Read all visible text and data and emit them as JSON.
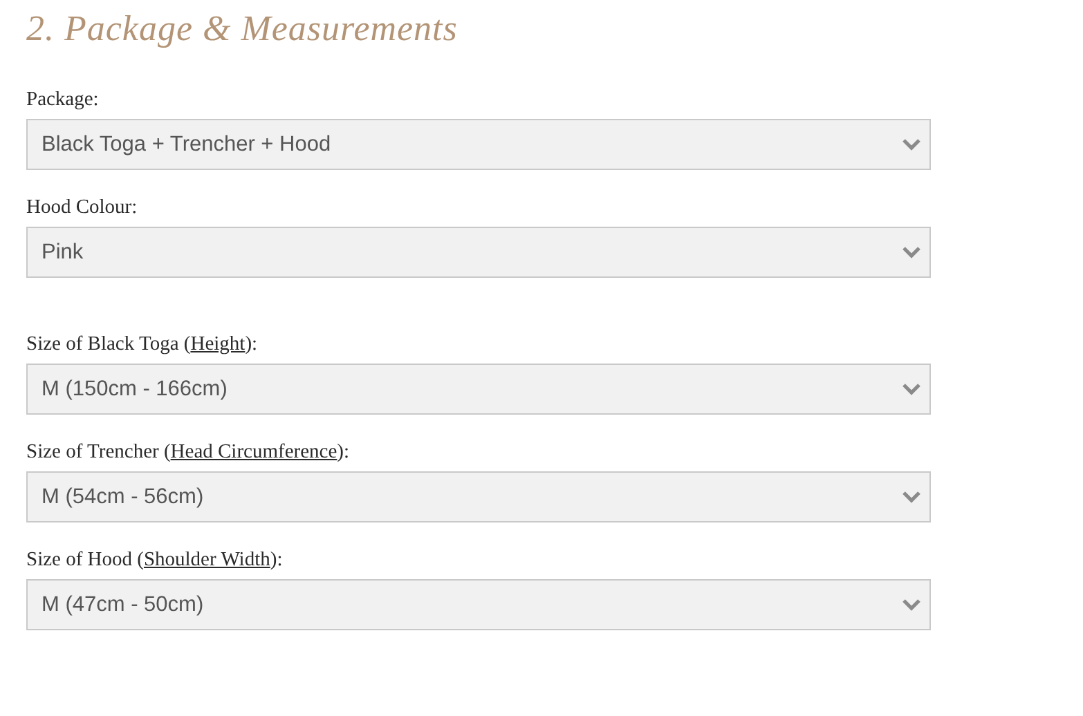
{
  "heading": "2. Package & Measurements",
  "groups": [
    {
      "fields": [
        {
          "label": "Package:",
          "value": "Black Toga + Trencher + Hood"
        },
        {
          "label": "Hood Colour:",
          "value": "Pink"
        }
      ]
    },
    {
      "fields": [
        {
          "label": "Size of Black Toga (",
          "link": "Height",
          "label_end": "):",
          "value": "M (150cm - 166cm)"
        },
        {
          "label": "Size of Trencher (",
          "link": "Head Circumference",
          "label_end": "):",
          "value": "M (54cm - 56cm)"
        },
        {
          "label": "Size of Hood (",
          "link": "Shoulder Width",
          "label_end": "):",
          "value": "M (47cm - 50cm)"
        }
      ]
    }
  ]
}
